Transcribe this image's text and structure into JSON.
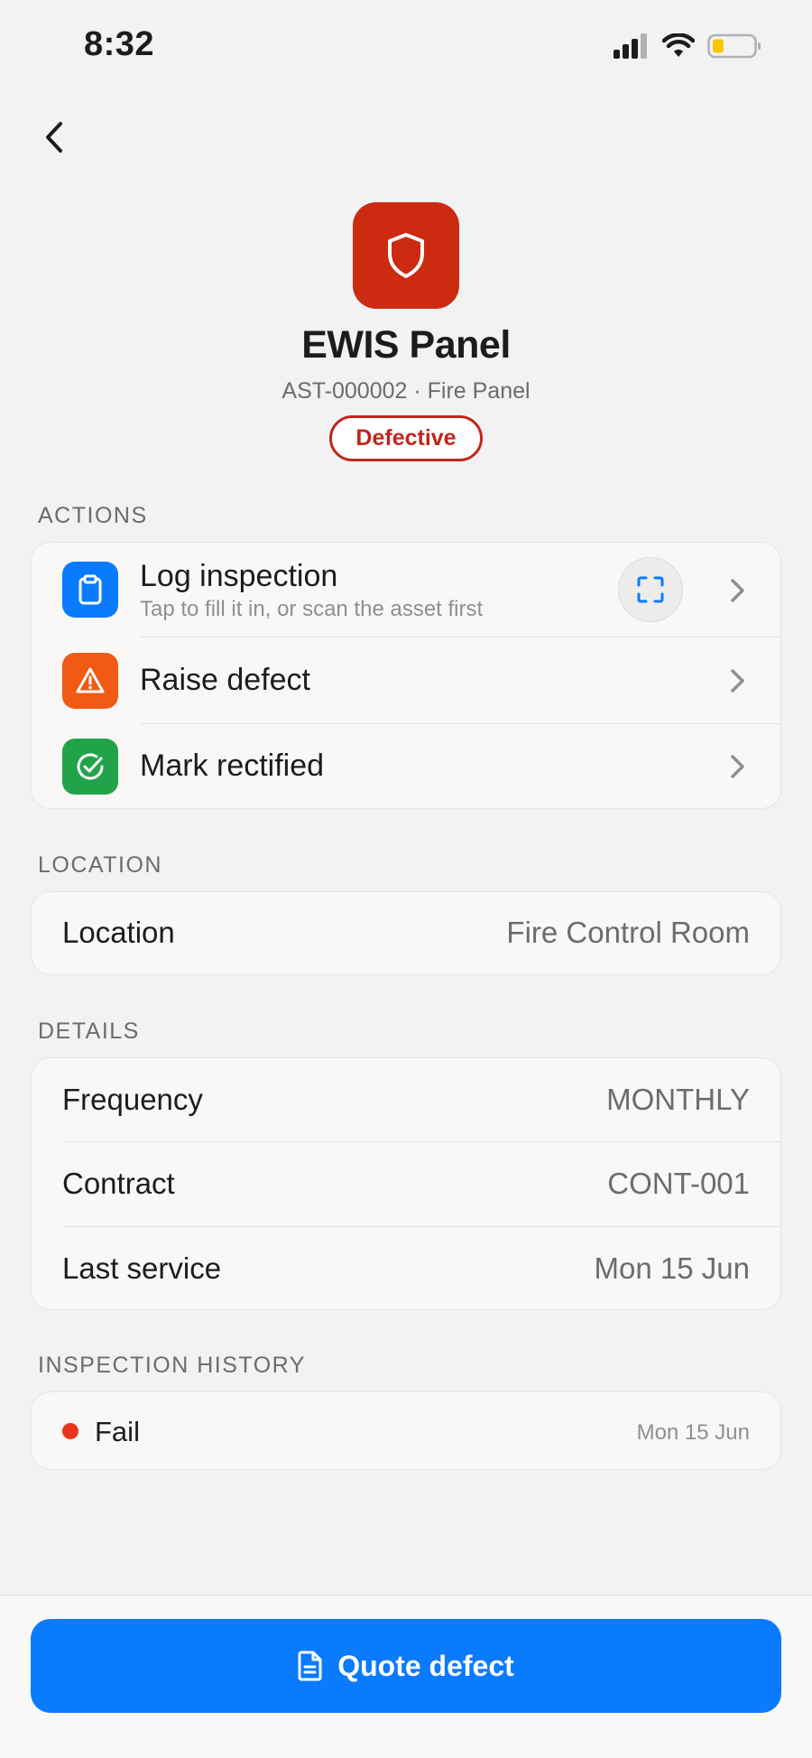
{
  "status_bar": {
    "time": "8:32",
    "icons": [
      "cellular-icon",
      "wifi-icon",
      "battery-icon"
    ]
  },
  "nav": {
    "back_icon": "chevron-left-icon"
  },
  "asset": {
    "icon": "shield-icon",
    "name": "EWIS Panel",
    "subtitle": "AST-000002 · Fire Panel",
    "status": "Defective",
    "colors": {
      "icon_bg": "#cc2b12",
      "status": "#c1261a"
    }
  },
  "sections": {
    "actions": "ACTIONS",
    "location": "LOCATION",
    "details": "DETAILS",
    "history": "INSPECTION HISTORY"
  },
  "actions": [
    {
      "title": "Log inspection",
      "subtitle": "Tap to fill it in, or scan the asset first",
      "icon": "clipboard-icon",
      "color": "#0a7aff",
      "has_scan": true
    },
    {
      "title": "Raise defect",
      "subtitle": "",
      "icon": "warning-icon",
      "color": "#f05a14",
      "has_scan": false
    },
    {
      "title": "Mark rectified",
      "subtitle": "",
      "icon": "check-circle-icon",
      "color": "#22a34a",
      "has_scan": false
    }
  ],
  "location": {
    "label": "Location",
    "value": "Fire Control Room"
  },
  "details": [
    {
      "label": "Frequency",
      "value": "MONTHLY"
    },
    {
      "label": "Contract",
      "value": "CONT-001"
    },
    {
      "label": "Last service",
      "value": "Mon 15 Jun"
    }
  ],
  "history": [
    {
      "result": "Fail",
      "date": "Mon 15 Jun",
      "color": "#e8341c"
    }
  ],
  "cta": {
    "label": "Quote defect",
    "icon": "document-icon",
    "color": "#0a7aff"
  }
}
